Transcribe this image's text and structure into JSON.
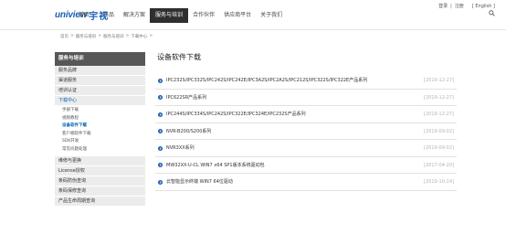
{
  "header": {
    "logo_en": "uniview",
    "logo_cn": "宇视",
    "top_links": {
      "login": "登录",
      "separator": "|",
      "register": "注册",
      "language": "[ English ]"
    },
    "nav": [
      {
        "label": "首页"
      },
      {
        "label": "产品"
      },
      {
        "label": "解决方案"
      },
      {
        "label": "服务与培训"
      },
      {
        "label": "合作伙伴"
      },
      {
        "label": "供应商平台"
      },
      {
        "label": "关于我们"
      }
    ],
    "active_nav_index": 3
  },
  "breadcrumb": [
    "首页",
    ">",
    "服务与培训",
    ">",
    "服务与培训",
    ">",
    "下载中心",
    ">"
  ],
  "sidebar": {
    "heading": "服务与培训",
    "items_before": [
      "服务品牌",
      "渠道服务",
      "培训认证"
    ],
    "current_item": "下载中心",
    "subitems": [
      {
        "label": "手册下载",
        "current": false
      },
      {
        "label": "视频教程",
        "current": false
      },
      {
        "label": "设备软件下载",
        "current": true
      },
      {
        "label": "客户端软件下载",
        "current": false
      },
      {
        "label": "SDK开发",
        "current": false
      },
      {
        "label": "常见问题处理",
        "current": false
      }
    ],
    "items_after": [
      "维修与更换",
      "License授权",
      "条码防伪查询",
      "条码保修查询",
      "产品生命周期查询"
    ]
  },
  "main": {
    "title": "设备软件下载",
    "rows": [
      {
        "title": "IPC232S/IPC332S/IPC242S/IPC242E/IPC3A2S/IPC2A2S/IPC212S/IPC322S/IPC322E产品系列",
        "date": "[2019-12-27]"
      },
      {
        "title": "IPC622SR产品系列",
        "date": "[2019-12-27]"
      },
      {
        "title": "IPC244S/IPC334S/IPC242S/IPC322E/IPC324E/IPC232S产品系列",
        "date": "[2019-12-27]"
      },
      {
        "title": "NVR-B200/S200系列",
        "date": "[2019-09-02]"
      },
      {
        "title": "NVR3XX系列",
        "date": "[2019-09-02]"
      },
      {
        "title": "MW32XX-U-CL WIN7 x64 SP1版本系统驱动包",
        "date": "[2017-04-20]"
      },
      {
        "title": "云智能显示终端 WIN7 64位驱动",
        "date": "[2019-10-14]"
      }
    ]
  },
  "colors": {
    "brand_blue": "#1a5fb4",
    "nav_active_bg": "#2f2f2f",
    "sidebar_head_bg": "#575757",
    "sidebar_item_bg": "#ececec",
    "link_blue": "#0a63b0",
    "date_gray": "#b5b5b5"
  },
  "icons": {
    "row_arrow": "circle-arrow-right-icon",
    "search": "search-icon"
  }
}
